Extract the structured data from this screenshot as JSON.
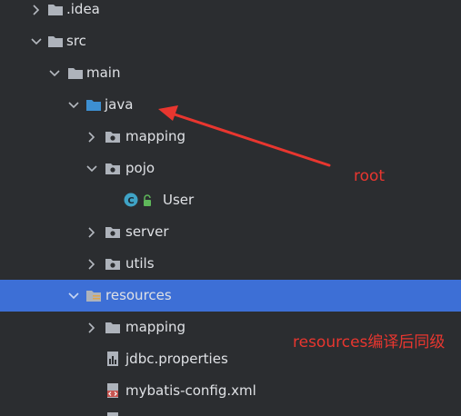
{
  "tree": {
    "items": [
      {
        "label": ".idea"
      },
      {
        "label": "src"
      },
      {
        "label": "main"
      },
      {
        "label": "java"
      },
      {
        "label": "mapping"
      },
      {
        "label": "pojo"
      },
      {
        "label": "User"
      },
      {
        "label": "server"
      },
      {
        "label": "utils"
      },
      {
        "label": "resources"
      },
      {
        "label": "mapping"
      },
      {
        "label": "jdbc.properties"
      },
      {
        "label": "mybatis-config.xml"
      }
    ]
  },
  "annotations": {
    "root": "root",
    "resources_note": "resources编译后同级"
  },
  "colors": {
    "background": "#2b2d30",
    "selection": "#3d6fd6",
    "annotation": "#e8362f",
    "java_folder": "#3d8fd1",
    "class_badge": "#3fa3c6"
  }
}
